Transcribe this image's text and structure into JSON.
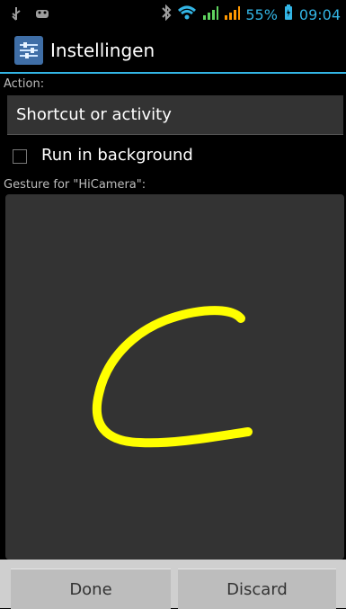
{
  "status_bar": {
    "battery_text": "55%",
    "time": "09:04",
    "icons": [
      "usb-icon",
      "android-debug-icon",
      "bluetooth-icon",
      "wifi-icon",
      "signal-icon",
      "signal-icon-2",
      "battery-icon"
    ]
  },
  "action_bar": {
    "title": "Instellingen",
    "icon": "settings-sliders-icon"
  },
  "form": {
    "action_label": "Action:",
    "action_value": "Shortcut or activity",
    "run_bg_label": "Run in background",
    "run_bg_checked": false,
    "gesture_label": "Gesture for \"HiCamera\":"
  },
  "gesture": {
    "stroke_color": "#ffff00",
    "letter": "C"
  },
  "buttons": {
    "done": "Done",
    "discard": "Discard"
  },
  "colors": {
    "accent": "#33b5e5",
    "pad": "#333333",
    "bar": "#bdbdbd"
  }
}
